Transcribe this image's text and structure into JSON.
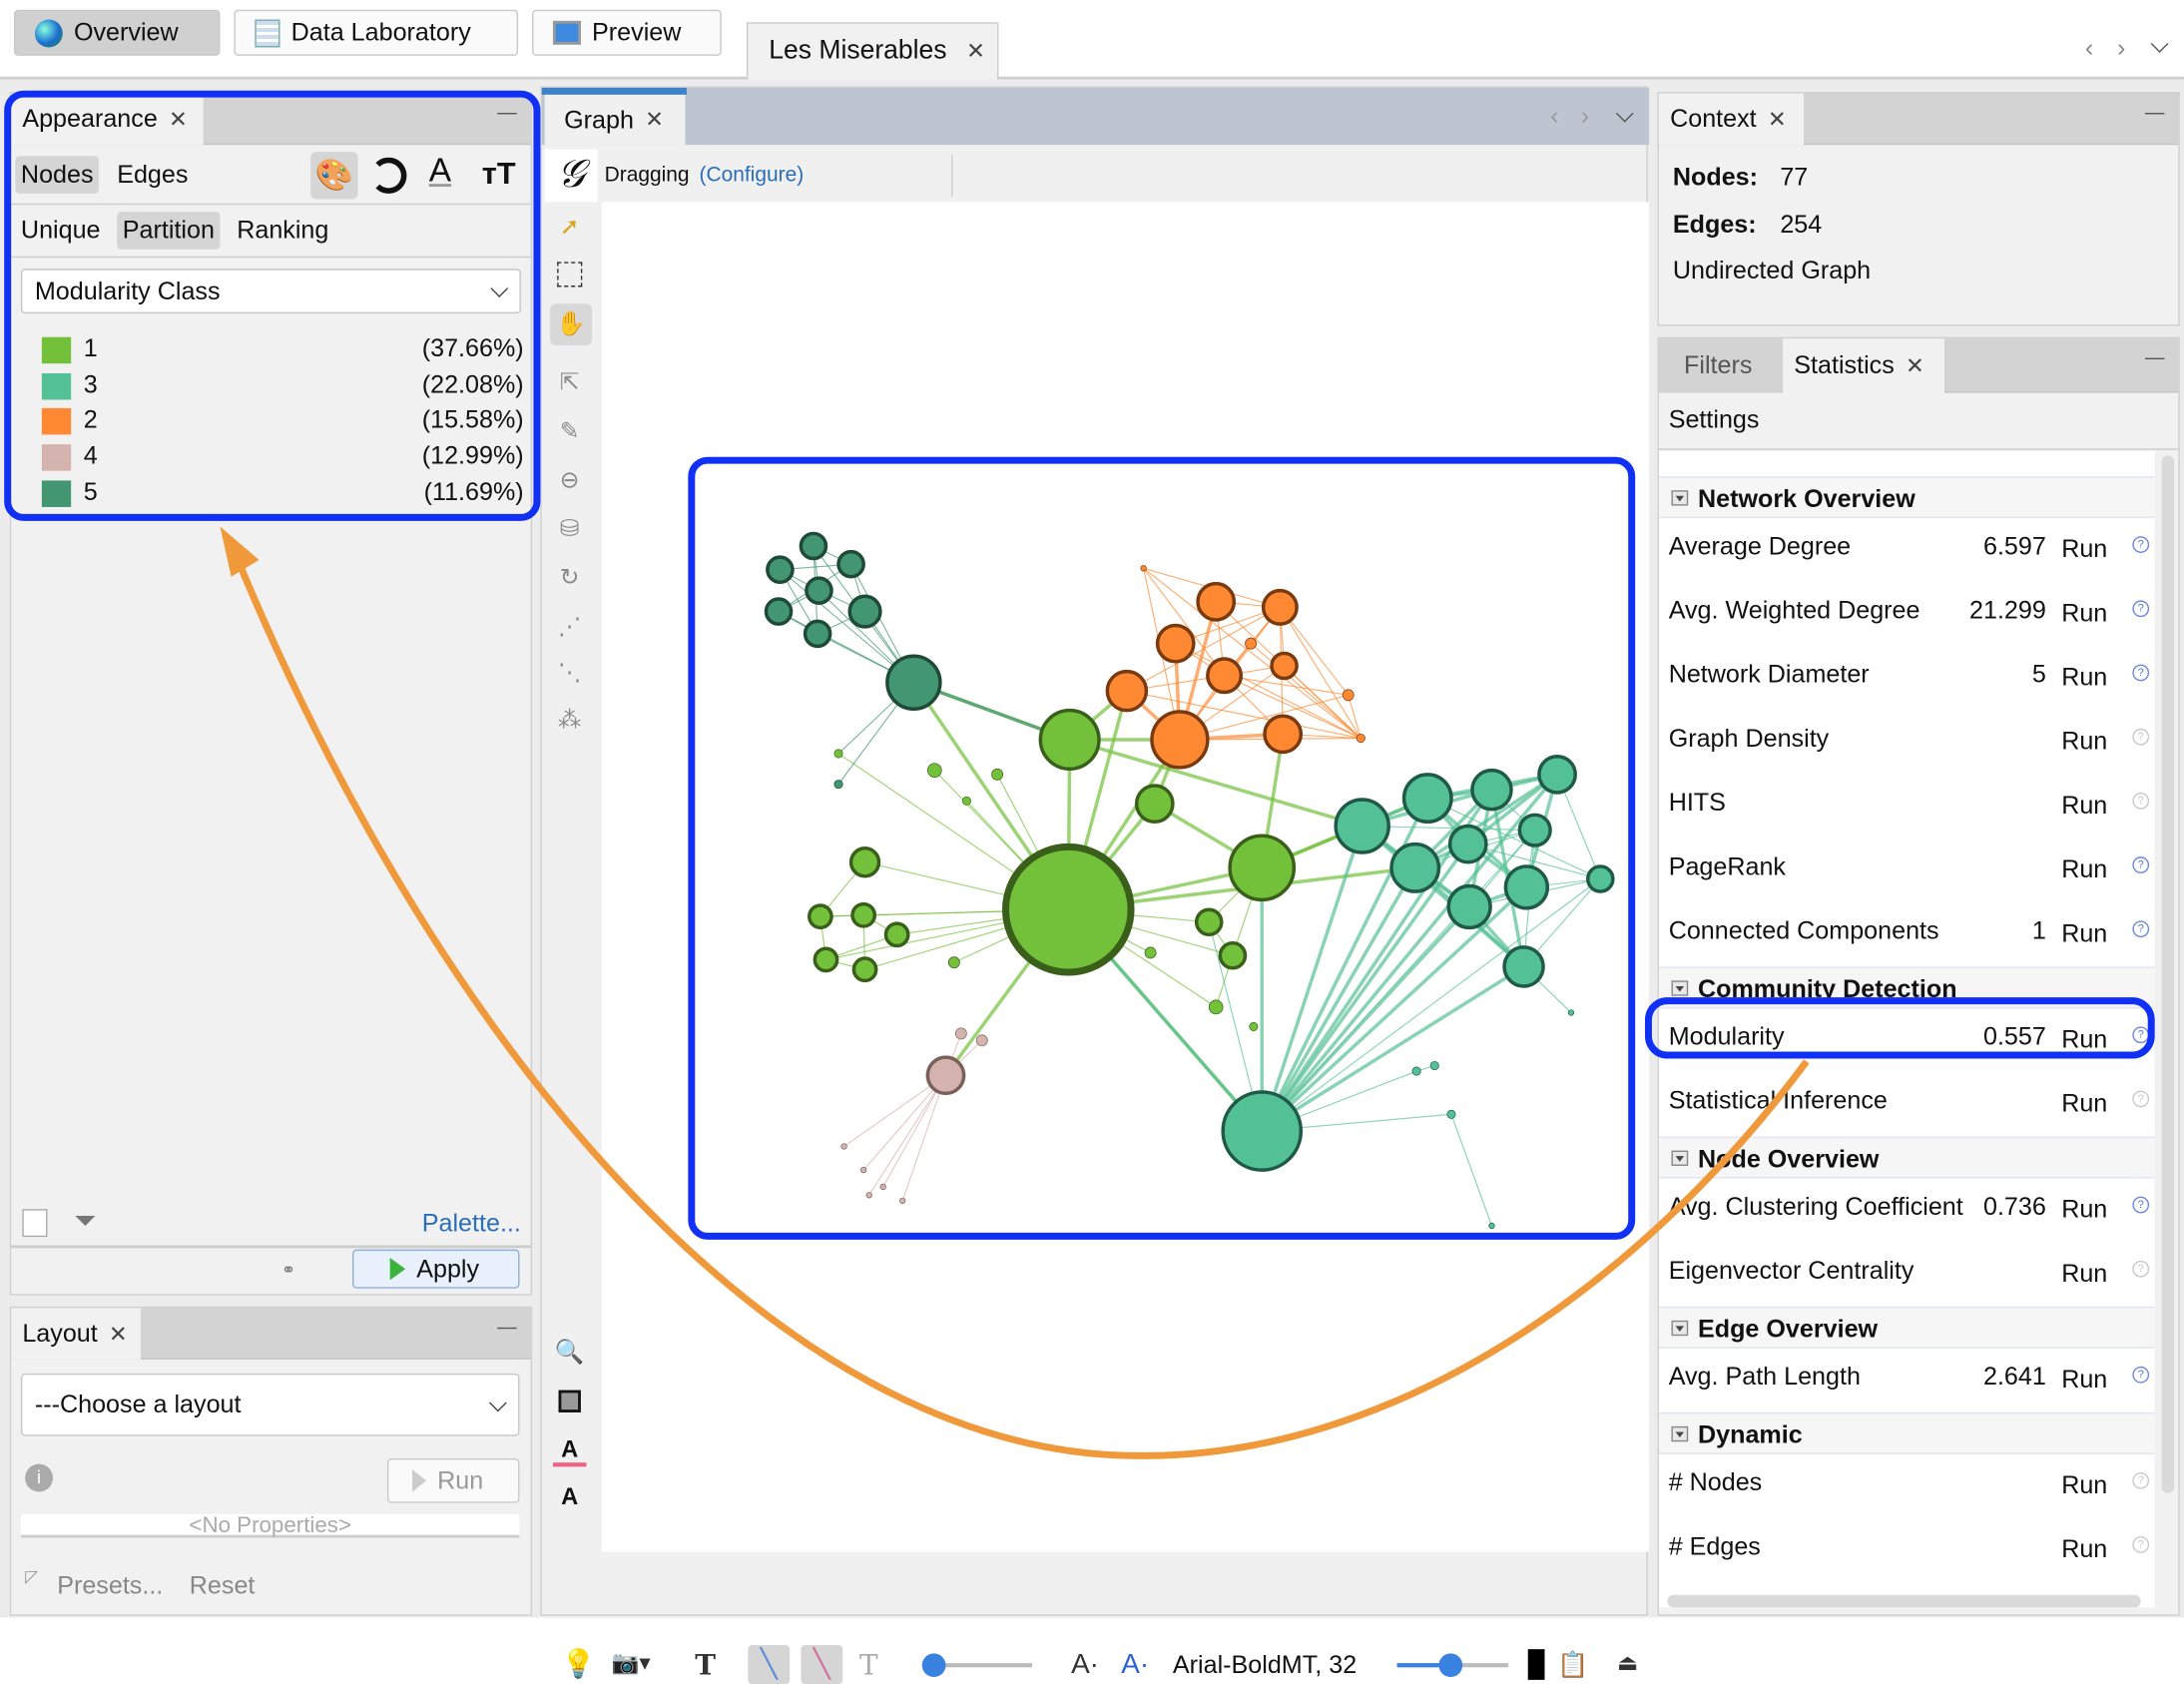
{
  "top_tabs": {
    "overview": "Overview",
    "data_laboratory": "Data Laboratory",
    "preview": "Preview",
    "workspace": "Les Miserables"
  },
  "appearance": {
    "title": "Appearance",
    "target_tabs": [
      "Nodes",
      "Edges"
    ],
    "modes": [
      "Unique",
      "Partition",
      "Ranking"
    ],
    "attribute": "Modularity Class",
    "partitions": [
      {
        "label": "1",
        "percent": "(37.66%)",
        "color": "#73c03a"
      },
      {
        "label": "3",
        "percent": "(22.08%)",
        "color": "#54c095"
      },
      {
        "label": "2",
        "percent": "(15.58%)",
        "color": "#fe8932"
      },
      {
        "label": "4",
        "percent": "(12.99%)",
        "color": "#d4b3ae"
      },
      {
        "label": "5",
        "percent": "(11.69%)",
        "color": "#429672"
      }
    ],
    "palette_link": "Palette...",
    "apply": "Apply"
  },
  "layout": {
    "title": "Layout",
    "select": "---Choose a layout",
    "run": "Run",
    "no_properties": "<No Properties>",
    "presets": "Presets...",
    "reset": "Reset"
  },
  "graph": {
    "title": "Graph",
    "mode": "Dragging",
    "configure": "(Configure)",
    "font_label": "Arial-BoldMT, 32"
  },
  "context": {
    "title": "Context",
    "nodes_label": "Nodes:",
    "nodes": "77",
    "edges_label": "Edges:",
    "edges": "254",
    "graph_type": "Undirected Graph"
  },
  "statistics": {
    "tabs": [
      "Filters",
      "Statistics"
    ],
    "settings": "Settings",
    "run_label": "Run",
    "sections": [
      {
        "title": "Network Overview",
        "items": [
          {
            "name": "Average Degree",
            "value": "6.597",
            "help": true
          },
          {
            "name": "Avg. Weighted Degree",
            "value": "21.299",
            "help": true
          },
          {
            "name": "Network Diameter",
            "value": "5",
            "help": true
          },
          {
            "name": "Graph Density",
            "value": "",
            "help": false
          },
          {
            "name": "HITS",
            "value": "",
            "help": false
          },
          {
            "name": "PageRank",
            "value": "",
            "help": true
          },
          {
            "name": "Connected Components",
            "value": "1",
            "help": true
          }
        ]
      },
      {
        "title": "Community Detection",
        "items": [
          {
            "name": "Modularity",
            "value": "0.557",
            "help": true
          },
          {
            "name": "Statistical Inference",
            "value": "",
            "help": false
          }
        ]
      },
      {
        "title": "Node Overview",
        "items": [
          {
            "name": "Avg. Clustering Coefficient",
            "value": "0.736",
            "help": true
          },
          {
            "name": "Eigenvector Centrality",
            "value": "",
            "help": false
          }
        ]
      },
      {
        "title": "Edge Overview",
        "items": [
          {
            "name": "Avg. Path Length",
            "value": "2.641",
            "help": true
          }
        ]
      },
      {
        "title": "Dynamic",
        "items": [
          {
            "name": "# Nodes",
            "value": "",
            "help": false
          },
          {
            "name": "# Edges",
            "value": "",
            "help": false
          }
        ]
      }
    ]
  },
  "colors": {
    "highlight": "#1030f5",
    "arrow": "#f0993a",
    "link": "#2a6ebb"
  }
}
